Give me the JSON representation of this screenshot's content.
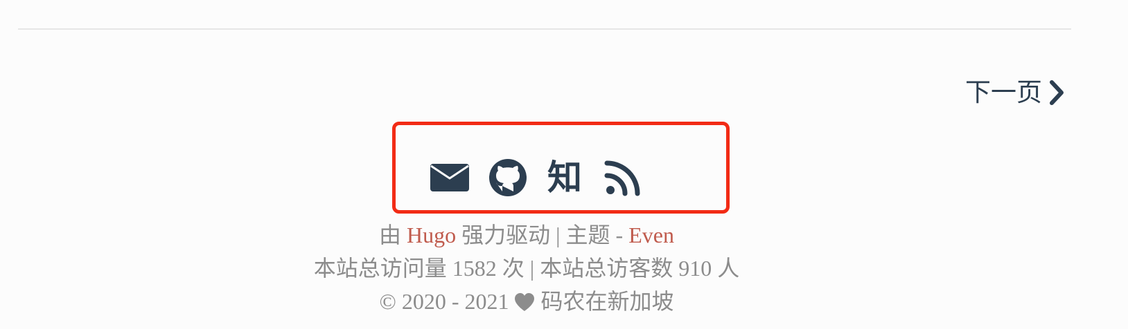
{
  "pagination": {
    "next_label": "下一页"
  },
  "social": {
    "links": [
      "mail-icon",
      "github-icon",
      "zhihu-icon",
      "rss-icon"
    ],
    "zhihu_text": "知"
  },
  "footer": {
    "powered_prefix": "由",
    "hugo_label": "Hugo",
    "powered_middle": "强力驱动 | 主题 -",
    "theme_label": "Even",
    "stats_prefix": "本站总访问量",
    "visits": "1582",
    "stats_middle": "次 | 本站总访客数",
    "visitors": "910",
    "stats_suffix": "人",
    "copyright_years": "© 2020 - 2021",
    "author": "码农在新加坡"
  },
  "colors": {
    "text_dark": "#2c3e50",
    "text_gray": "#8c8c8c",
    "accent_red": "#c05b4d",
    "highlight_red": "#f22b15"
  }
}
